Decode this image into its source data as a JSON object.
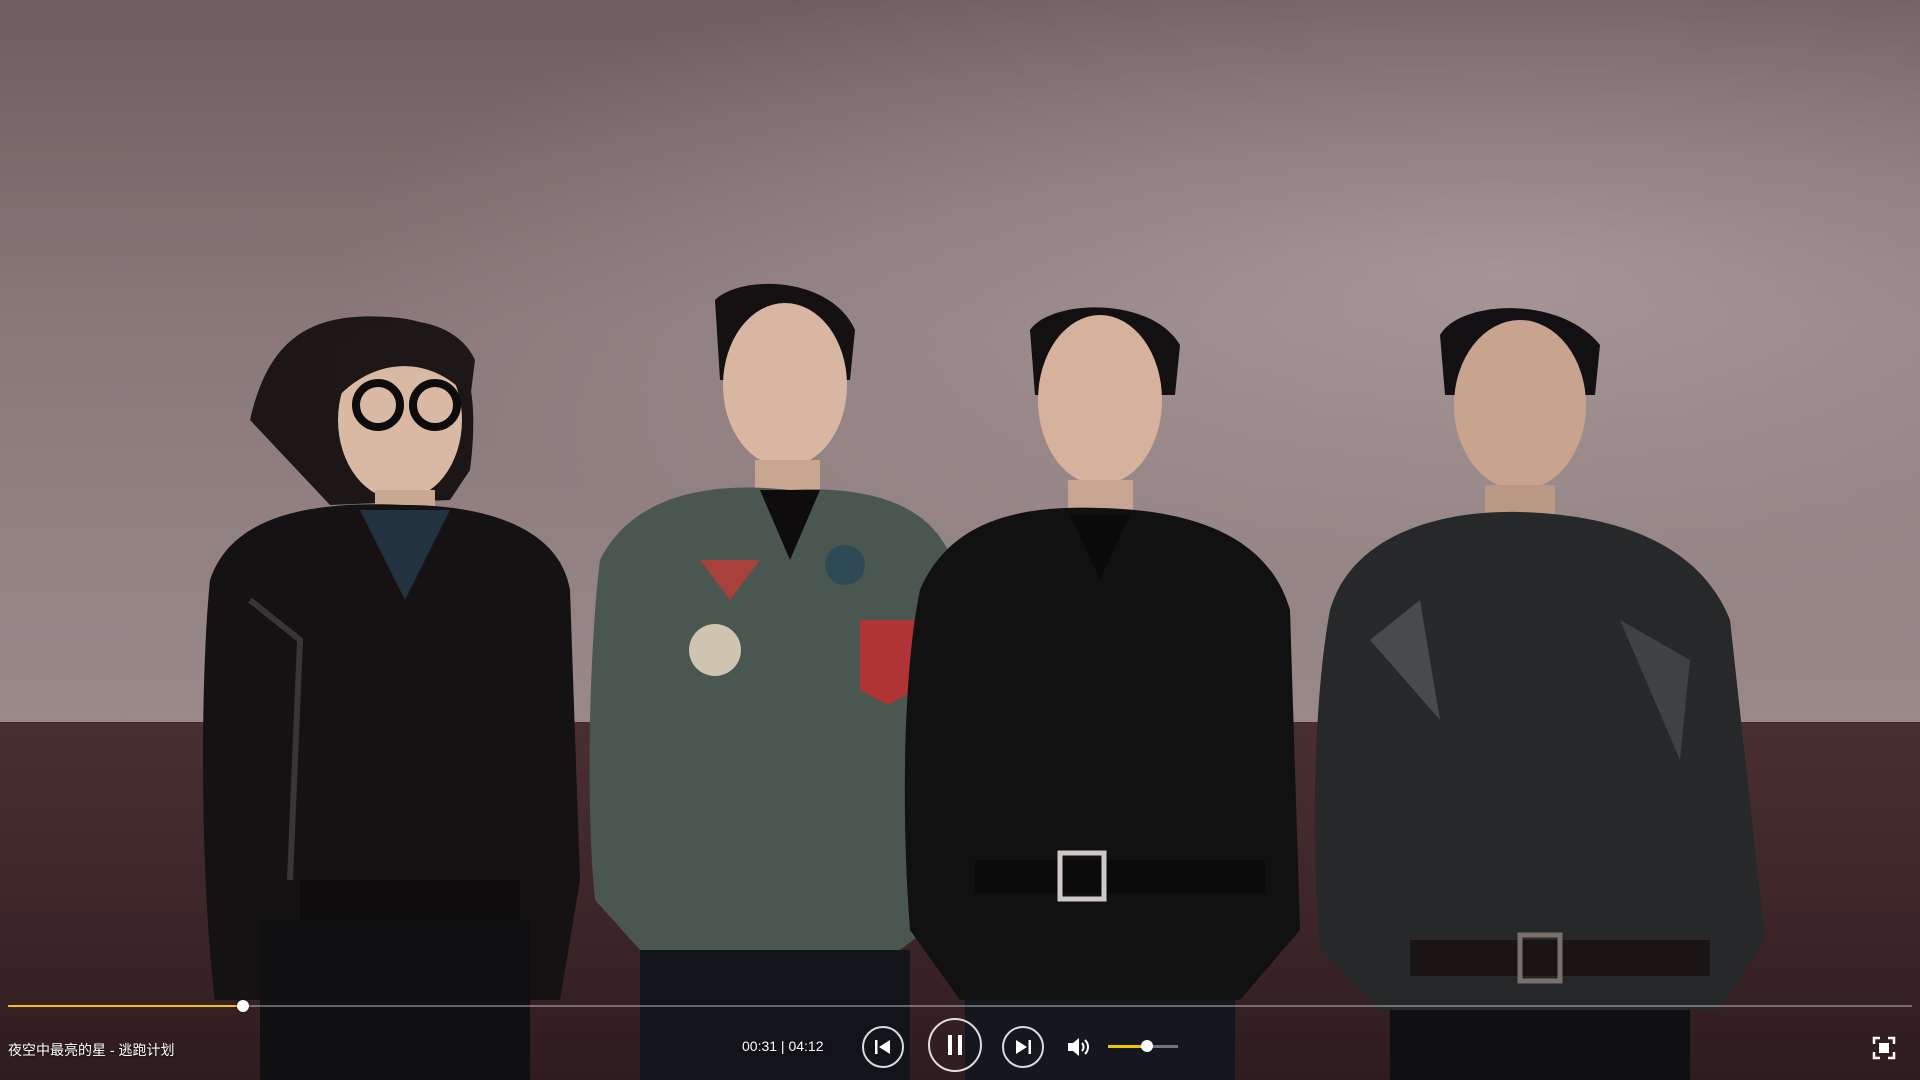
{
  "player": {
    "song_title": "夜空中最亮的星 - 逃跑计划",
    "time_readout": "00:31 | 04:12",
    "progress": 0.1234,
    "volume": 0.55,
    "accent_color": "#f2c200"
  },
  "controls": {
    "previous_icon": "skip-previous-icon",
    "pause_icon": "pause-icon",
    "next_icon": "skip-next-icon",
    "volume_icon": "speaker-icon",
    "fullscreen_icon": "fullscreen-icon"
  }
}
